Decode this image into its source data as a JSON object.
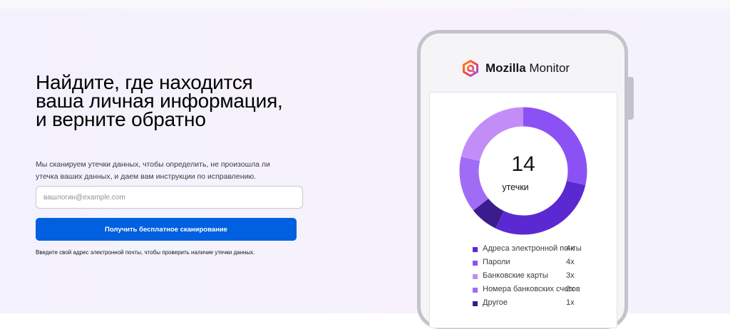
{
  "hero": {
    "headline": "Найдите, где находится ваша личная информация, и верните обратно",
    "subtitle": "Мы сканируем утечки данных, чтобы определить, не произошла ли утечка ваших данных, и даем вам инструкции по исправлению.",
    "email_placeholder": "вашлогин@example.com",
    "email_value": "",
    "scan_button_label": "Получить бесплатное сканирование",
    "helper_text": "Введите свой адрес электронной почты, чтобы проверить наличие утечки данных."
  },
  "phone": {
    "brand_bold": "Mozilla",
    "brand_rest": " Monitor",
    "logo_icon": "mozilla-monitor-logo-icon",
    "breach_count": "14",
    "breach_label": "утечки",
    "legend": [
      {
        "label": "Адреса электронной почты",
        "count": "4x",
        "color": "#5b29d1",
        "value": 4
      },
      {
        "label": "Пароли",
        "count": "4x",
        "color": "#8c51f5",
        "value": 4
      },
      {
        "label": "Банковские карты",
        "count": "3x",
        "color": "#c38df7",
        "value": 3
      },
      {
        "label": "Номера банковских счетов",
        "count": "2x",
        "color": "#a06cf6",
        "value": 2
      },
      {
        "label": "Другое",
        "count": "1x",
        "color": "#3a1c8c",
        "value": 1
      }
    ]
  },
  "colors": {
    "accent": "#0060df",
    "hero_background": "#f4f2fc"
  }
}
